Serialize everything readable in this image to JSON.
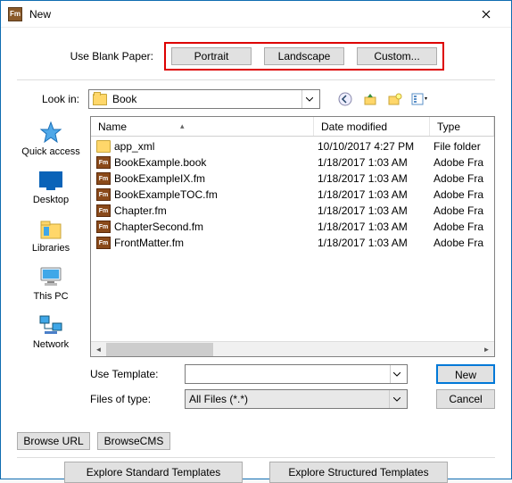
{
  "window": {
    "title": "New"
  },
  "blank": {
    "label": "Use Blank Paper:",
    "portrait": "Portrait",
    "landscape": "Landscape",
    "custom": "Custom..."
  },
  "lookin": {
    "label": "Look in:",
    "value": "Book"
  },
  "places": {
    "quick": "Quick access",
    "desktop": "Desktop",
    "libraries": "Libraries",
    "thispc": "This PC",
    "network": "Network"
  },
  "columns": {
    "name": "Name",
    "date": "Date modified",
    "type": "Type"
  },
  "files": [
    {
      "icon": "folder",
      "name": "app_xml",
      "date": "10/10/2017 4:27 PM",
      "type": "File folder"
    },
    {
      "icon": "fm",
      "name": "BookExample.book",
      "date": "1/18/2017 1:03 AM",
      "type": "Adobe Fra"
    },
    {
      "icon": "fm",
      "name": "BookExampleIX.fm",
      "date": "1/18/2017 1:03 AM",
      "type": "Adobe Fra"
    },
    {
      "icon": "fm",
      "name": "BookExampleTOC.fm",
      "date": "1/18/2017 1:03 AM",
      "type": "Adobe Fra"
    },
    {
      "icon": "fm",
      "name": "Chapter.fm",
      "date": "1/18/2017 1:03 AM",
      "type": "Adobe Fra"
    },
    {
      "icon": "fm",
      "name": "ChapterSecond.fm",
      "date": "1/18/2017 1:03 AM",
      "type": "Adobe Fra"
    },
    {
      "icon": "fm",
      "name": "FrontMatter.fm",
      "date": "1/18/2017 1:03 AM",
      "type": "Adobe Fra"
    }
  ],
  "form": {
    "useTemplateLabel": "Use Template:",
    "useTemplateValue": "",
    "filesOfTypeLabel": "Files of type:",
    "filesOfTypeValue": "All Files (*.*)",
    "new": "New",
    "cancel": "Cancel"
  },
  "browse": {
    "url": "Browse URL",
    "cms": "BrowseCMS"
  },
  "templates": {
    "std": "Explore Standard Templates",
    "struct": "Explore Structured Templates"
  }
}
